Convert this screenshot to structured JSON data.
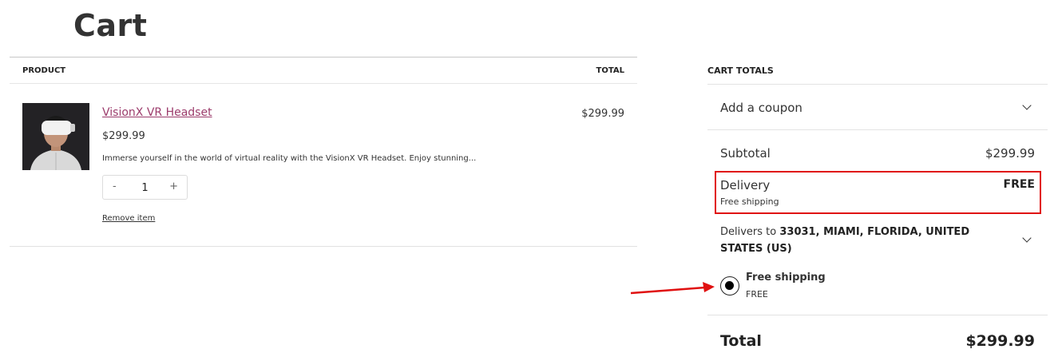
{
  "page_title": "Cart",
  "cart_table": {
    "col_product": "PRODUCT",
    "col_total": "TOTAL"
  },
  "item": {
    "name": "VisionX VR Headset",
    "price": "$299.99",
    "description": "Immerse yourself in the world of virtual reality with the VisionX VR Headset. Enjoy stunning...",
    "qty_minus": "-",
    "quantity": "1",
    "qty_plus": "+",
    "remove_label": "Remove item",
    "line_total": "$299.99"
  },
  "totals": {
    "heading": "CART TOTALS",
    "coupon_label": "Add a coupon",
    "subtotal_label": "Subtotal",
    "subtotal_value": "$299.99",
    "delivery_label": "Delivery",
    "delivery_value": "FREE",
    "delivery_method": "Free shipping",
    "delivers_to_prefix": "Delivers to",
    "delivers_to_address": "33031, MIAMI, FLORIDA, UNITED STATES (US)",
    "shipping_option_name": "Free shipping",
    "shipping_option_price": "FREE",
    "total_label": "Total",
    "total_value": "$299.99"
  },
  "colors": {
    "annotation_red": "#e01010",
    "link_color": "#9c3c6c"
  }
}
